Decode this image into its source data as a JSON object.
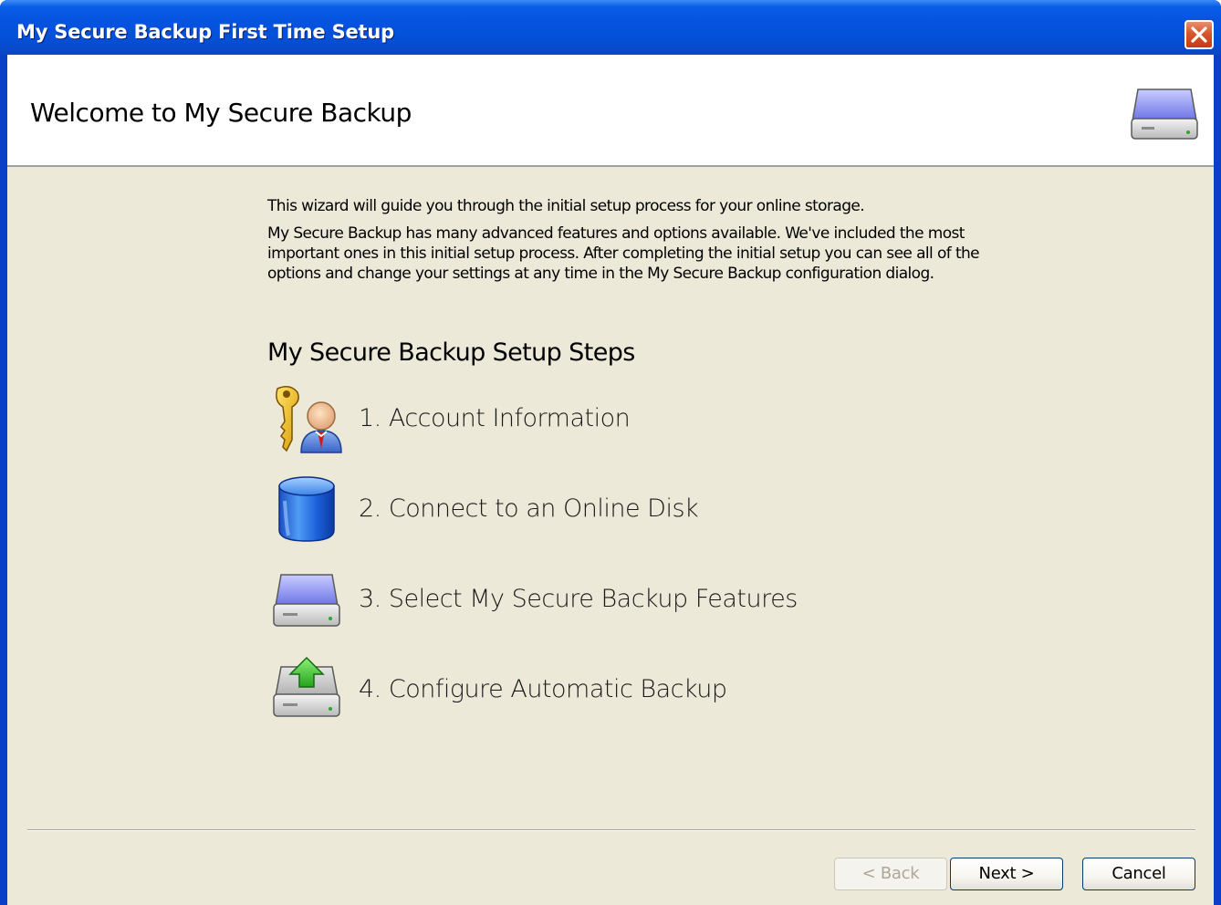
{
  "window": {
    "title": "My Secure Backup First Time Setup"
  },
  "header": {
    "title": "Welcome to My Secure Backup",
    "icon": "hard-drive-icon"
  },
  "intro": {
    "paragraph1": "This wizard will guide you through the initial setup process for your online storage.",
    "paragraph2": "My Secure Backup has many advanced features and options available. We've included the most important ones in this initial setup process. After completing the initial setup you can see all of the options and change your settings at any time in the My Secure Backup configuration dialog."
  },
  "steps": {
    "title": "My Secure Backup Setup Steps",
    "items": [
      {
        "label": "1. Account Information",
        "icon": "key-user-icon"
      },
      {
        "label": "2. Connect to an Online Disk",
        "icon": "database-icon"
      },
      {
        "label": "3. Select My Secure Backup Features",
        "icon": "hard-drive-icon"
      },
      {
        "label": "4. Configure Automatic Backup",
        "icon": "drive-upload-icon"
      }
    ]
  },
  "buttons": {
    "back": "< Back",
    "next": "Next >",
    "cancel": "Cancel"
  },
  "colors": {
    "titlebar": "#0553e0",
    "client_bg": "#ece9d8",
    "close_button": "#d8552c"
  }
}
